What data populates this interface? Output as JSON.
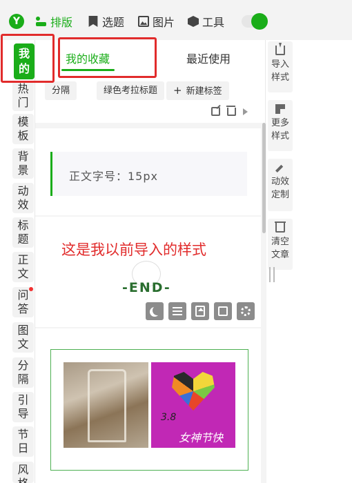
{
  "topbar": {
    "logo": "Y",
    "nav": [
      {
        "label": "排版",
        "icon": "layout-icon",
        "active": true
      },
      {
        "label": "选题",
        "icon": "bookmark-icon",
        "active": false
      },
      {
        "label": "图片",
        "icon": "image-icon",
        "active": false
      },
      {
        "label": "工具",
        "icon": "cube-icon",
        "active": false
      }
    ],
    "toggle_on": true
  },
  "left_tabs": [
    "我的",
    "热门",
    "模板",
    "背景",
    "动效",
    "标题",
    "正文",
    "问答",
    "图文",
    "分隔",
    "引导",
    "节日",
    "风格"
  ],
  "panel": {
    "tabs": [
      "我的收藏",
      "最近使用"
    ],
    "chips": [
      "分隔",
      "绿色考拉标题",
      "新建标签"
    ],
    "chip_new_prefix": "+",
    "card1_text": "正文字号：15px",
    "card2_note": "这是我以前导入的样式",
    "card2_end": "-END-",
    "card3_caption": "女神节快",
    "card3_num": "3.8"
  },
  "right_tools": [
    {
      "label1": "导入",
      "label2": "样式",
      "icon": "import-icon"
    },
    {
      "label1": "更多",
      "label2": "样式",
      "icon": "grid-icon"
    },
    {
      "label1": "动效",
      "label2": "定制",
      "icon": "wand-icon"
    },
    {
      "label1": "清空",
      "label2": "文章",
      "icon": "trash-icon"
    }
  ],
  "colors": {
    "accent": "#1aad19",
    "highlight": "#e12b2b"
  }
}
